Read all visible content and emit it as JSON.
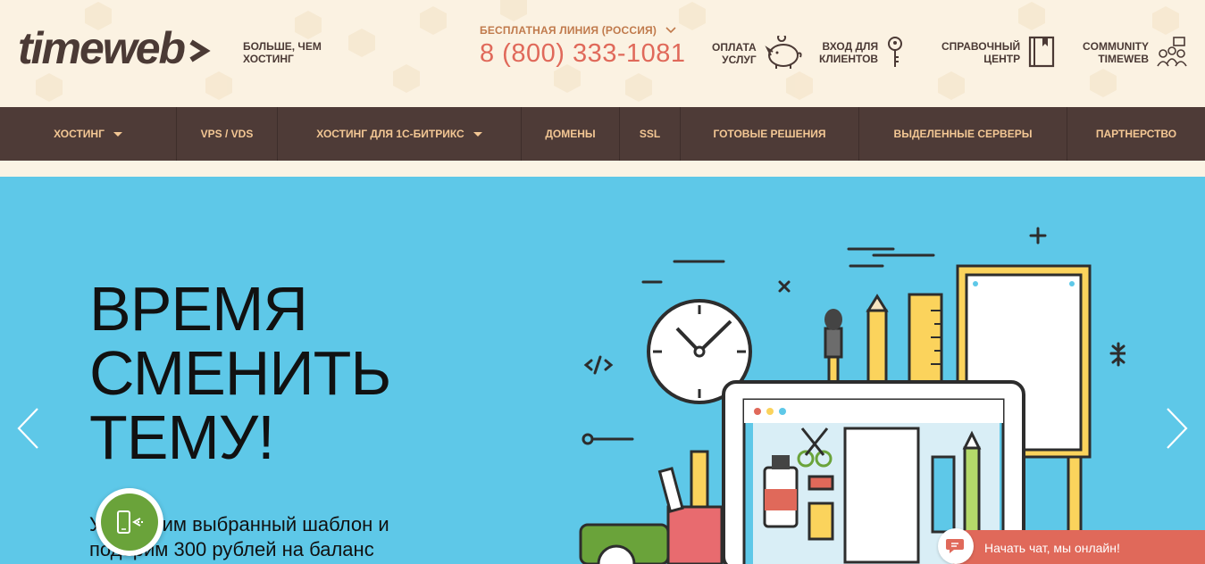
{
  "header": {
    "logo": "timeweb",
    "tagline": "БОЛЬШЕ, ЧЕМ ХОСТИНГ",
    "hotline_label": "БЕСПЛАТНАЯ ЛИНИЯ (РОССИЯ)",
    "hotline_number": "8 (800) 333-1081",
    "links": [
      {
        "label_line1": "ОПЛАТА",
        "label_line2": "УСЛУГ",
        "icon": "piggy-bank-icon"
      },
      {
        "label_line1": "ВХОД ДЛЯ",
        "label_line2": "КЛИЕНТОВ",
        "icon": "key-icon"
      },
      {
        "label_line1": "СПРАВОЧНЫЙ",
        "label_line2": "ЦЕНТР",
        "icon": "book-icon"
      },
      {
        "label_line1": "COMMUNITY",
        "label_line2": "TIMEWEB",
        "icon": "community-icon"
      }
    ]
  },
  "nav": {
    "items": [
      {
        "label": "ХОСТИНГ",
        "dropdown": true
      },
      {
        "label": "VPS / VDS",
        "dropdown": false
      },
      {
        "label": "ХОСТИНГ ДЛЯ 1С-БИТРИКС",
        "dropdown": true
      },
      {
        "label": "ДОМЕНЫ",
        "dropdown": false
      },
      {
        "label": "SSL",
        "dropdown": false
      },
      {
        "label": "ГОТОВЫЕ РЕШЕНИЯ",
        "dropdown": false
      },
      {
        "label": "ВЫДЕЛЕННЫЕ СЕРВЕРЫ",
        "dropdown": false
      },
      {
        "label": "ПАРТНЕРСТВО",
        "dropdown": false
      }
    ]
  },
  "hero": {
    "title_line1": "ВРЕМЯ",
    "title_line2": "СМЕНИТЬ",
    "title_line3": "ТЕМУ!",
    "subtitle_line1": "Установим выбранный шаблон и",
    "subtitle_line2": "подарим 300 рублей на баланс"
  },
  "chat": {
    "label": "Начать чат, мы онлайн!"
  },
  "colors": {
    "brand_brown": "#4e3b37",
    "nav_text": "#f3c794",
    "accent_red": "#e0695a",
    "hero_bg": "#5ec8e8",
    "header_bg": "#fbf2e2"
  }
}
